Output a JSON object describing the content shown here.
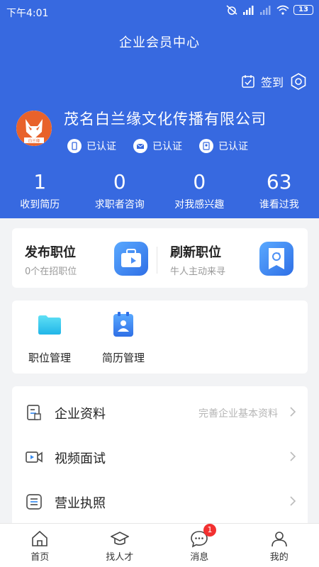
{
  "status_bar": {
    "time": "下午4:01",
    "battery": "13"
  },
  "header": {
    "title": "企业会员中心",
    "signin_label": "签到",
    "company_name": "茂名白兰缘文化传播有限公司",
    "logo_text": "白兰缘",
    "verifications": [
      {
        "icon": "phone-icon",
        "label": "已认证"
      },
      {
        "icon": "mail-icon",
        "label": "已认证"
      },
      {
        "icon": "license-icon",
        "label": "已认证"
      }
    ],
    "stats": [
      {
        "value": "1",
        "label": "收到简历"
      },
      {
        "value": "0",
        "label": "求职者咨询"
      },
      {
        "value": "0",
        "label": "对我感兴趣"
      },
      {
        "value": "63",
        "label": "谁看过我"
      }
    ]
  },
  "actions": {
    "publish": {
      "title": "发布职位",
      "subtitle": "0个在招职位"
    },
    "refresh": {
      "title": "刷新职位",
      "subtitle": "牛人主动来寻"
    }
  },
  "tools": [
    {
      "icon": "folder-icon",
      "label": "职位管理"
    },
    {
      "icon": "resume-icon",
      "label": "简历管理"
    }
  ],
  "menu": [
    {
      "icon": "company-info-icon",
      "label": "企业资料",
      "hint": "完善企业基本资料"
    },
    {
      "icon": "video-icon",
      "label": "视频面试",
      "hint": ""
    },
    {
      "icon": "license-doc-icon",
      "label": "营业执照",
      "hint": ""
    }
  ],
  "tabbar": [
    {
      "icon": "home-icon",
      "label": "首页"
    },
    {
      "icon": "graduation-cap-icon",
      "label": "找人才"
    },
    {
      "icon": "message-icon",
      "label": "消息",
      "badge": "1"
    },
    {
      "icon": "user-icon",
      "label": "我的"
    }
  ],
  "colors": {
    "brand": "#3769e0",
    "accent": "#3b8df0",
    "badge": "#f23030"
  }
}
